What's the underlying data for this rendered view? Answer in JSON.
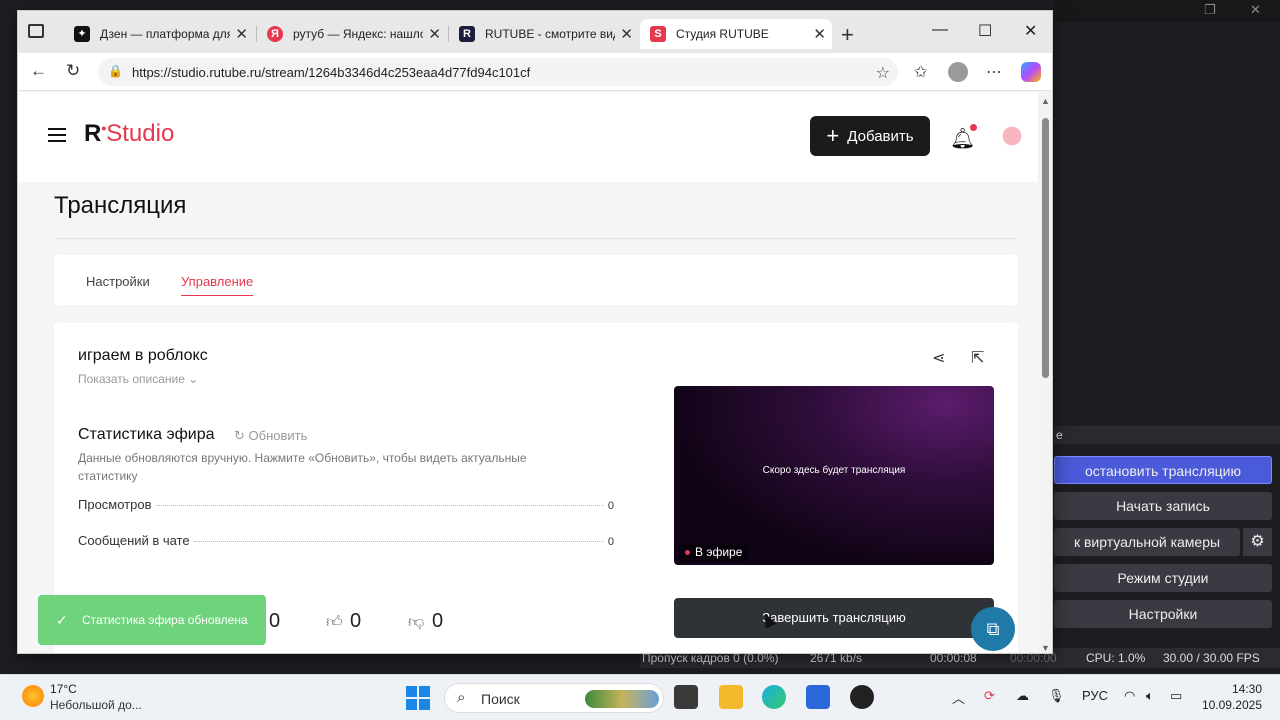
{
  "obs": {
    "panel_title": "е",
    "buttons": [
      "остановить трансляцию",
      "Начать запись",
      "к виртуальной камеры",
      "Режим студии",
      "Настройки"
    ],
    "gear_icon": "gear-icon",
    "status": {
      "dropped": "Пропуск кадров 0 (0.0%)",
      "kbps": "2671 kb/s",
      "time1": "00:00:08",
      "time2": "00:00:00",
      "cpu": "CPU: 1.0%",
      "fps": "30.00 / 30.00 FPS"
    }
  },
  "browser": {
    "tabs": [
      {
        "title": "Дзен — платформа для",
        "favicon": "zen-icon",
        "color": "#111111"
      },
      {
        "title": "рутуб — Яндекс: нашло",
        "favicon": "yandex-icon",
        "color": "#e5384f"
      },
      {
        "title": "RUTUBE - смотрите вид",
        "favicon": "rutube-icon",
        "color": "#1b1f3b"
      },
      {
        "title": "Студия RUTUBE",
        "favicon": "rutube-studio-icon",
        "color": "#e5384f"
      }
    ],
    "url": "https://studio.rutube.ru/stream/1264b3346d4c253eaa4d77fd94c101cf"
  },
  "page": {
    "logo_r": "R",
    "logo_studio": "Studio",
    "add_label": "Добавить",
    "title": "Трансляция",
    "tabs": [
      "Настройки",
      "Управление"
    ],
    "stream_name": "играем в роблокс",
    "show_description": "Показать описание",
    "stats_title": "Статистика эфира",
    "refresh_label": "Обновить",
    "stats_note": "Данные обновляются вручную. Нажмите «Обновить», чтобы видеть актуальные статистику",
    "stats": [
      {
        "label": "Просмотров",
        "value": "0"
      },
      {
        "label": "Сообщений в чате",
        "value": "0"
      }
    ],
    "reactions": {
      "views": "0",
      "likes": "0",
      "dislikes": "0"
    },
    "preview_text": "Скоро здесь будет трансляция",
    "live_label": "В эфире",
    "end_button": "Завершить трансляцию",
    "toast": "Статистика эфира обновлена"
  },
  "taskbar": {
    "temp": "17°C",
    "weather": "Небольшой до...",
    "search": "Поиск",
    "lang": "РУС",
    "time": "14:30",
    "date": "10.09.2025"
  },
  "colors": {
    "accent": "#e5384f",
    "toast": "#6fd37c",
    "obs_active": "#4a5ad8"
  }
}
